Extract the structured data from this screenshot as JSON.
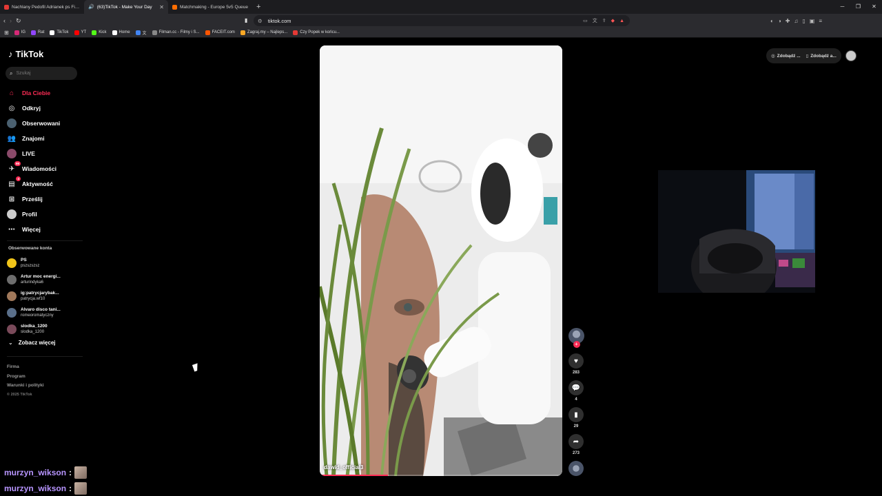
{
  "browser": {
    "tabs": [
      {
        "title": "Nachlany Pedofil Adrianek ps Filozof",
        "active": false,
        "favicon_color": "#e53935"
      },
      {
        "title": "(63)TikTok - Make Your Day",
        "active": true,
        "favicon_color": "#ffffff"
      },
      {
        "title": "Matchmaking - Europe 5v5 Queue",
        "active": false,
        "favicon_color": "#ff6d00"
      }
    ],
    "new_tab": "+",
    "url": "tiktok.com",
    "bookmarks": [
      {
        "label": "IG",
        "color": "#d62976"
      },
      {
        "label": "Rat",
        "color": "#9146ff"
      },
      {
        "label": "TikTok",
        "color": "#ffffff"
      },
      {
        "label": "YT",
        "color": "#ff0000"
      },
      {
        "label": "Kick",
        "color": "#53fc18"
      },
      {
        "label": "Home",
        "color": "#ffffff"
      },
      {
        "label": "文",
        "color": "#4285f4"
      },
      {
        "label": "Filman.cc - Filmy i S...",
        "color": "#888888"
      },
      {
        "label": "FACEIT.com",
        "color": "#ff5500"
      },
      {
        "label": "Zagraj.my – Najleps...",
        "color": "#f9a825"
      },
      {
        "label": "Czy Popek w końcu...",
        "color": "#e53935"
      }
    ]
  },
  "sidebar": {
    "logo": "TikTok",
    "search_placeholder": "Szukaj",
    "nav": [
      {
        "label": "Dla Ciebie",
        "icon": "home-icon",
        "active": true
      },
      {
        "label": "Odkryj",
        "icon": "compass-icon"
      },
      {
        "label": "Obserwowani",
        "icon": "following-icon"
      },
      {
        "label": "Znajomi",
        "icon": "friends-icon"
      },
      {
        "label": "LIVE",
        "icon": "live-icon"
      },
      {
        "label": "Wiadomości",
        "icon": "messages-icon",
        "badge": "99"
      },
      {
        "label": "Aktywność",
        "icon": "activity-icon",
        "badge": "4"
      },
      {
        "label": "Prześlij",
        "icon": "upload-icon"
      },
      {
        "label": "Profil",
        "icon": "profile-icon"
      },
      {
        "label": "Więcej",
        "icon": "more-icon"
      }
    ],
    "followed_title": "Obserwowane konta",
    "followed": [
      {
        "name": "PS",
        "username": "pszszszsz",
        "color": "#f0c419"
      },
      {
        "name": "Artur moc energi...",
        "username": "arturindyka6",
        "color": "#6d6d6d"
      },
      {
        "name": "ig:patrycjarybak...",
        "username": "patrycja.wf10",
        "color": "#a0785a"
      },
      {
        "name": "Alvaro disco tani...",
        "username": "romeoromatyczny",
        "color": "#5a6f8a"
      },
      {
        "name": "slodka_1200",
        "username": "slodka_1200",
        "color": "#7a4a5a"
      }
    ],
    "see_more": "Zobacz więcej",
    "footer": [
      "Firma",
      "Program",
      "Warunki i polityki"
    ],
    "copyright": "© 2025 TikTok"
  },
  "video": {
    "author": "dawid_official3",
    "progress": 0.28,
    "actions": {
      "likes": "283",
      "comments": "4",
      "saves": "29",
      "shares": "273"
    }
  },
  "top_right": {
    "btn1": "Zdobądź ...",
    "btn2": "Zdobądź a..."
  },
  "chat": [
    {
      "user": "murzyn_wikson",
      "sep": ":"
    },
    {
      "user": "murzyn_wikson",
      "sep": ":"
    }
  ]
}
